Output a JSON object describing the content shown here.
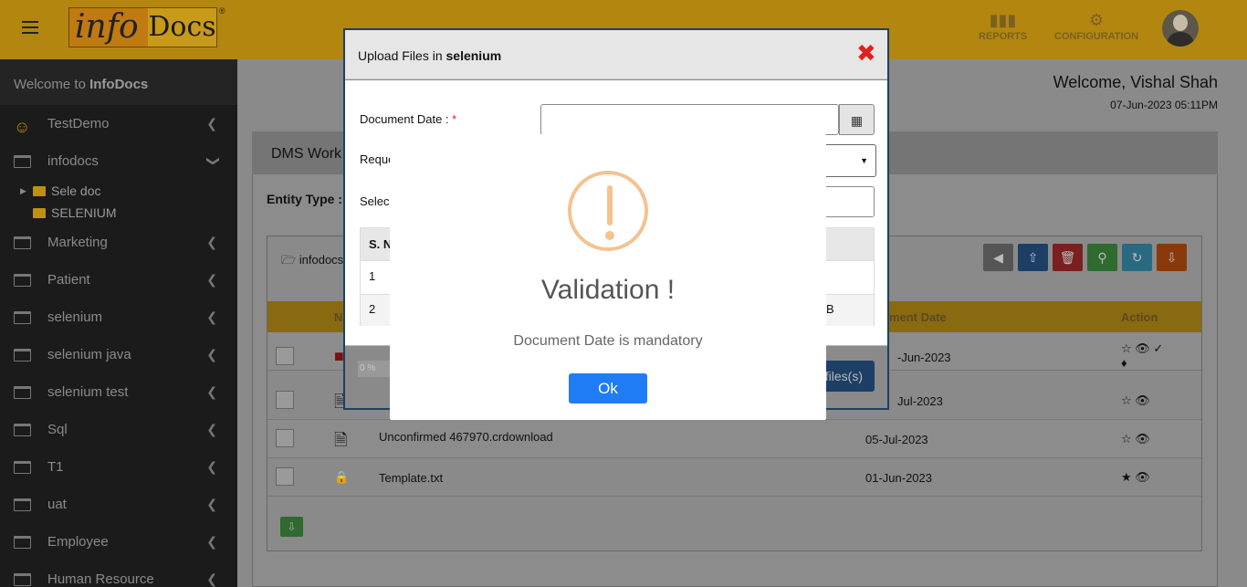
{
  "header": {
    "logo_part1": "info",
    "logo_part2": "Docs",
    "logo_reg": "®",
    "reports_label": "REPORTS",
    "configuration_label": "CONFIGURATION"
  },
  "sidebar": {
    "welcome_prefix": "Welcome to ",
    "welcome_brand": "InfoDocs",
    "items": [
      {
        "label": "TestDemo",
        "icon": "user-icon"
      },
      {
        "label": "infodocs",
        "icon": "folder-icon",
        "expanded": true
      },
      {
        "label": "Marketing",
        "icon": "folder-icon"
      },
      {
        "label": "Patient",
        "icon": "folder-icon"
      },
      {
        "label": "selenium",
        "icon": "folder-icon"
      },
      {
        "label": "selenium java",
        "icon": "folder-icon"
      },
      {
        "label": "selenium test",
        "icon": "folder-icon"
      },
      {
        "label": "Sql",
        "icon": "folder-icon"
      },
      {
        "label": "T1",
        "icon": "folder-icon"
      },
      {
        "label": "uat",
        "icon": "folder-icon"
      },
      {
        "label": "Employee",
        "icon": "folder-icon"
      },
      {
        "label": "Human Resource",
        "icon": "folder-icon"
      }
    ],
    "subitems": [
      {
        "label": "Sele doc"
      },
      {
        "label": "SELENIUM"
      }
    ]
  },
  "user": {
    "welcome": "Welcome, Vishal Shah",
    "datetime": "07-Jun-2023 05:11PM"
  },
  "main": {
    "panel_title": "DMS Work",
    "entity_label": "Entity Type :",
    "breadcrumb": "infodocs",
    "columns": {
      "name": "N",
      "document_date": "ument Date",
      "action": "Action"
    },
    "rows": [
      {
        "name": "",
        "date": "-Jun-2023"
      },
      {
        "name": "",
        "date": "Jul-2023"
      },
      {
        "name": "Unconfirmed 467970.crdownload",
        "date": "05-Jul-2023"
      },
      {
        "name": "Template.txt",
        "date": "01-Jun-2023"
      }
    ]
  },
  "upload_modal": {
    "title_prefix": "Upload Files in ",
    "title_folder": "selenium",
    "document_date_label": "Document Date : ",
    "required_mark": "*",
    "request_label": "Reque",
    "select_label": "Selec",
    "table_header_sn": "S. N",
    "table_header_right": "e",
    "rows": [
      {
        "sn": "1",
        "right": ""
      },
      {
        "sn": "2",
        "right": "B"
      }
    ],
    "progress": "0 %",
    "upload_button": "files(s)"
  },
  "dialog": {
    "title": "Validation !",
    "message": "Document Date is mandatory",
    "ok_label": "Ok",
    "accent_color": "#f5c28f",
    "button_color": "#1f7cf5"
  }
}
